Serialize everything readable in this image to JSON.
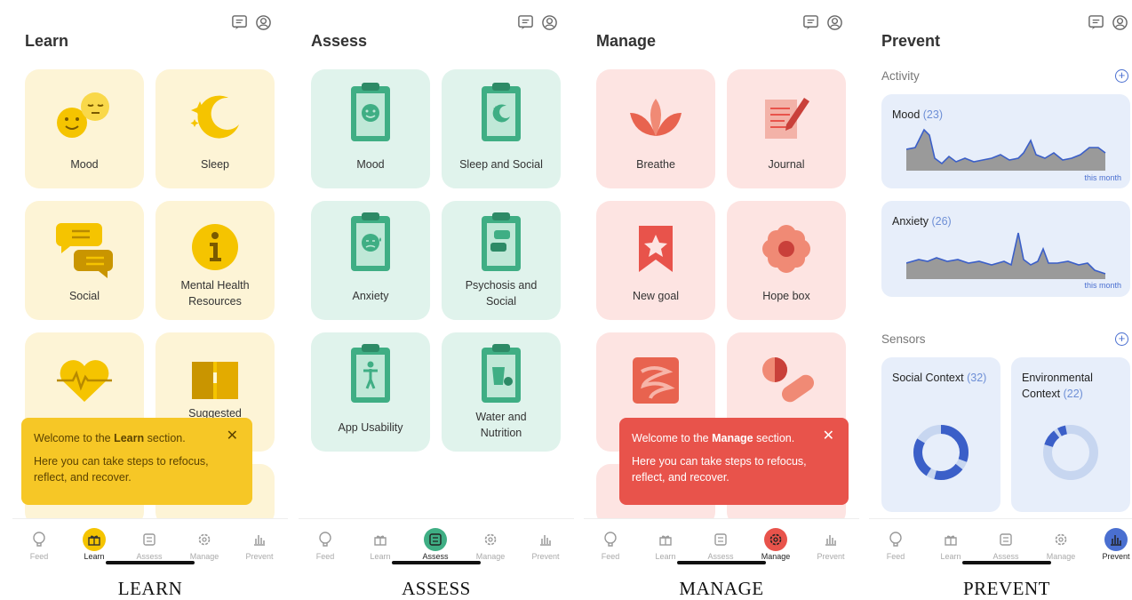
{
  "common": {
    "top_icons": [
      "chat-icon",
      "profile-icon"
    ]
  },
  "nav_labels": [
    "Feed",
    "Learn",
    "Assess",
    "Manage",
    "Prevent"
  ],
  "learn": {
    "title": "Learn",
    "tiles": [
      "Mood",
      "Sleep",
      "Social",
      "Mental Health\nResources",
      "",
      "Suggested"
    ],
    "toast": {
      "line1_pre": "Welcome to the ",
      "line1_bold": "Learn",
      "line1_post": " section.",
      "line2": "Here you can take steps to refocus, reflect, and recover.",
      "close": "✕"
    },
    "caption": "LEARN",
    "accent": "#f5c400"
  },
  "assess": {
    "title": "Assess",
    "tiles": [
      "Mood",
      "Sleep and Social",
      "Anxiety",
      "Psychosis and\nSocial",
      "App Usability",
      "Water and\nNutrition"
    ],
    "caption": "ASSESS",
    "accent": "#3fae84"
  },
  "manage": {
    "title": "Manage",
    "tiles": [
      "Breathe",
      "Journal",
      "New goal",
      "Hope box",
      "",
      ""
    ],
    "toast": {
      "line1_pre": "Welcome to the ",
      "line1_bold": "Manage",
      "line1_post": " section.",
      "line2": "Here you can take steps to refocus, reflect, and recover.",
      "close": "✕"
    },
    "caption": "MANAGE",
    "accent": "#e8534b"
  },
  "prevent": {
    "title": "Prevent",
    "activity_header": "Activity",
    "sensors_header": "Sensors",
    "mood_label": "Mood",
    "mood_count": "(23)",
    "anxiety_label": "Anxiety",
    "anxiety_count": "(26)",
    "this_month": "this month",
    "social_label": "Social Context",
    "social_count": "(32)",
    "env_label_1": "Environmental",
    "env_label_2": "Context",
    "env_count": "(22)",
    "caption": "PREVENT",
    "accent": "#4a6fd0"
  }
}
